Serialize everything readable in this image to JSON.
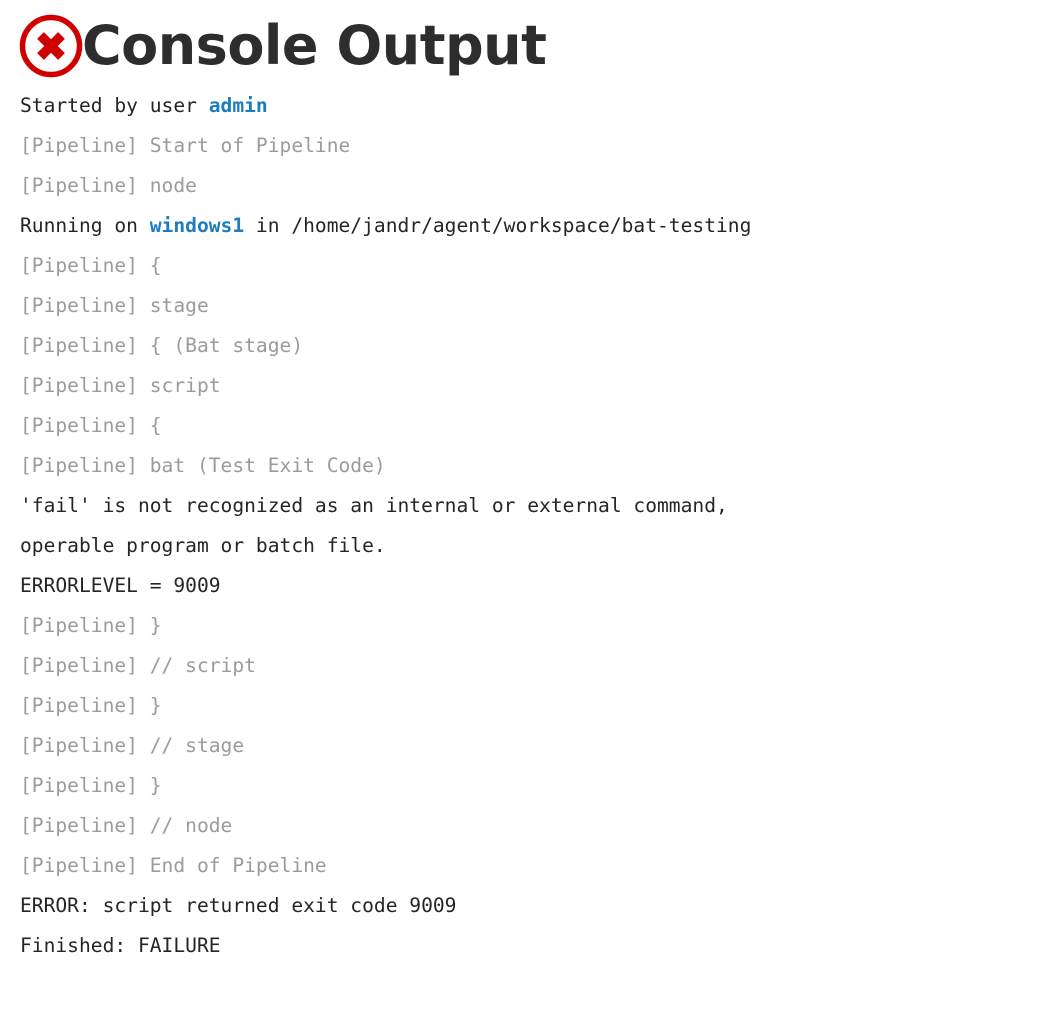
{
  "header": {
    "title": "Console Output",
    "status_icon": "error-circle-x-icon",
    "status_icon_color": "#d10000",
    "title_color": "#2d2d2d"
  },
  "colors": {
    "background": "#ffffff",
    "default_text": "#252525",
    "muted_text": "#9b9b9b",
    "link_text": "#1d7cbf",
    "error_red": "#d10000"
  },
  "console": {
    "lines": [
      {
        "segments": [
          {
            "text": "Started by user ",
            "style": "default"
          },
          {
            "text": "admin",
            "style": "link"
          }
        ]
      },
      {
        "segments": [
          {
            "text": "[Pipeline] Start of Pipeline",
            "style": "muted"
          }
        ]
      },
      {
        "segments": [
          {
            "text": "[Pipeline] node",
            "style": "muted"
          }
        ]
      },
      {
        "segments": [
          {
            "text": "Running on ",
            "style": "default"
          },
          {
            "text": "windows1",
            "style": "link"
          },
          {
            "text": " in /home/jandr/agent/workspace/bat-testing",
            "style": "default"
          }
        ]
      },
      {
        "segments": [
          {
            "text": "[Pipeline] {",
            "style": "muted"
          }
        ]
      },
      {
        "segments": [
          {
            "text": "[Pipeline] stage",
            "style": "muted"
          }
        ]
      },
      {
        "segments": [
          {
            "text": "[Pipeline] { (Bat stage)",
            "style": "muted"
          }
        ]
      },
      {
        "segments": [
          {
            "text": "[Pipeline] script",
            "style": "muted"
          }
        ]
      },
      {
        "segments": [
          {
            "text": "[Pipeline] {",
            "style": "muted"
          }
        ]
      },
      {
        "segments": [
          {
            "text": "[Pipeline] bat (Test Exit Code)",
            "style": "muted"
          }
        ]
      },
      {
        "segments": [
          {
            "text": "'fail' is not recognized as an internal or external command,",
            "style": "default"
          }
        ]
      },
      {
        "segments": [
          {
            "text": "operable program or batch file.",
            "style": "default"
          }
        ]
      },
      {
        "segments": [
          {
            "text": "ERRORLEVEL = 9009",
            "style": "default"
          }
        ]
      },
      {
        "segments": [
          {
            "text": "[Pipeline] }",
            "style": "muted"
          }
        ]
      },
      {
        "segments": [
          {
            "text": "[Pipeline] // script",
            "style": "muted"
          }
        ]
      },
      {
        "segments": [
          {
            "text": "[Pipeline] }",
            "style": "muted"
          }
        ]
      },
      {
        "segments": [
          {
            "text": "[Pipeline] // stage",
            "style": "muted"
          }
        ]
      },
      {
        "segments": [
          {
            "text": "[Pipeline] }",
            "style": "muted"
          }
        ]
      },
      {
        "segments": [
          {
            "text": "[Pipeline] // node",
            "style": "muted"
          }
        ]
      },
      {
        "segments": [
          {
            "text": "[Pipeline] End of Pipeline",
            "style": "muted"
          }
        ]
      },
      {
        "segments": [
          {
            "text": "ERROR: script returned exit code 9009",
            "style": "default"
          }
        ]
      },
      {
        "segments": [
          {
            "text": "Finished: FAILURE",
            "style": "default"
          }
        ]
      }
    ]
  }
}
